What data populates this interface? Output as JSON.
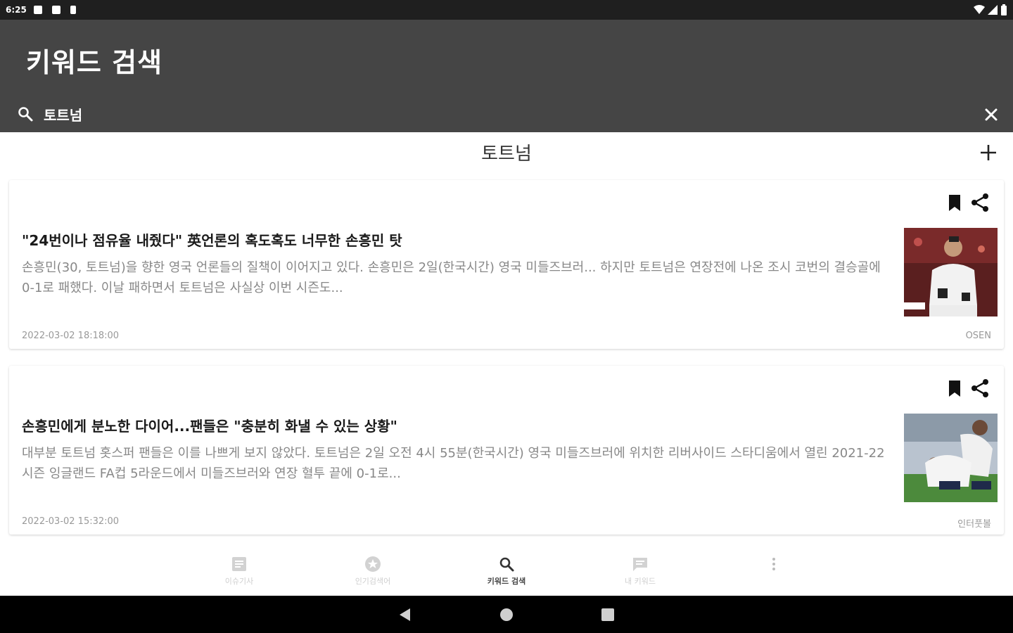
{
  "status_bar": {
    "time": "6:25"
  },
  "app_bar": {
    "title": "키워드 검색",
    "search_value": "토트넘",
    "search_placeholder": ""
  },
  "keyword_header": {
    "title": "토트넘"
  },
  "articles": [
    {
      "headline": "\"24번이나 점유율 내줬다\" 英언론의 혹도혹도 너무한 손흥민 탓",
      "summary": "손흥민(30, 토트넘)을 향한 영국 언론들의 질책이 이어지고 있다. 손흥민은 2일(한국시간) 영국 미들즈브러... 하지만 토트넘은 연장전에 나온 조시 코번의 결승골에 0-1로 패했다. 이날 패하면서 토트넘은 사실상 이번 시즌도...",
      "date": "2022-03-02 18:18:00",
      "source": "OSEN"
    },
    {
      "headline": "손흥민에게 분노한 다이어...팬들은 \"충분히 화낼 수 있는 상황\"",
      "summary": "대부분 토트넘 홋스퍼 팬들은 이를 나쁘게 보지 않았다. 토트넘은 2일 오전 4시 55분(한국시간) 영국 미들즈브러에 위치한 리버사이드 스타디움에서 열린 2021-22시즌 잉글랜드 FA컵 5라운드에서 미들즈브러와 연장 혈투 끝에 0-1로...",
      "date": "2022-03-02 15:32:00",
      "source": "인터풋볼"
    }
  ],
  "bottom_nav": {
    "items": [
      {
        "label": "이슈기사",
        "icon": "article-icon"
      },
      {
        "label": "인기검색어",
        "icon": "star-icon"
      },
      {
        "label": "키워드 검색",
        "icon": "search-icon"
      },
      {
        "label": "내 키워드",
        "icon": "message-icon"
      },
      {
        "label": "",
        "icon": "more-vertical-icon"
      }
    ]
  },
  "colors": {
    "app_bar": "#454545",
    "status_bar": "#1f1f1f",
    "active_nav": "#444444",
    "inactive_nav": "#cfcfcf"
  }
}
